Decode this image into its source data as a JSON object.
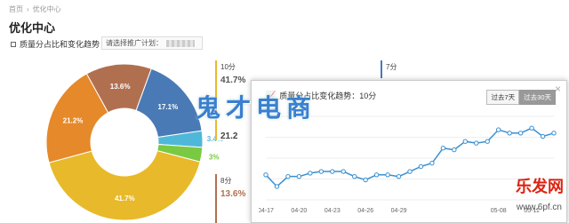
{
  "breadcrumb": {
    "home": "首页",
    "current": "优化中心"
  },
  "page_title": "优化中心",
  "section_label": "质量分占比和变化趋势",
  "plan_select_label": "请选择推广计划：",
  "pie": {
    "slices": [
      {
        "label": "17.1%",
        "value": 17.1,
        "color": "#4a7ab5"
      },
      {
        "label": "3.4%",
        "value": 3.4,
        "color": "#4fb8d8"
      },
      {
        "label": "3%",
        "value": 3.0,
        "color": "#7ac943"
      },
      {
        "label": "41.7%",
        "value": 41.7,
        "color": "#e8b92a"
      },
      {
        "label": "21.2%",
        "value": 21.2,
        "color": "#e5892a"
      },
      {
        "label": "13.6%",
        "value": 13.6,
        "color": "#b07050"
      }
    ]
  },
  "cards": [
    {
      "score": "10分",
      "percent": "41.7%",
      "color": "#e8b92a"
    },
    {
      "score": "7分",
      "percent": "",
      "color": "#4a7ab5"
    },
    {
      "score": "",
      "percent": "21.2",
      "color": "#e5892a"
    },
    {
      "score": "8分",
      "percent": "13.6%",
      "color": "#b07050"
    }
  ],
  "popup": {
    "title": "质量分占比变化趋势：10分",
    "btn_7": "过去7天",
    "btn_30": "过去30天",
    "close": "×",
    "chart_data": {
      "type": "line",
      "x": [
        "04-17",
        "04-18",
        "04-19",
        "04-20",
        "04-21",
        "04-22",
        "04-23",
        "04-24",
        "04-25",
        "04-26",
        "04-27",
        "04-28",
        "04-29",
        "04-30",
        "05-01",
        "05-02",
        "05-03",
        "05-04",
        "05-05",
        "05-06",
        "05-07",
        "05-08",
        "05-09",
        "05-10",
        "05-11",
        "05-12",
        "05-13"
      ],
      "xticks": [
        "04-17",
        "04-20",
        "04-23",
        "04-26",
        "04-29",
        "05-08",
        "05-11"
      ],
      "values": [
        15,
        8,
        14,
        14,
        16,
        17,
        17,
        17,
        14,
        12,
        15,
        15,
        14,
        17,
        20,
        22,
        31,
        30,
        35,
        34,
        35,
        42,
        40,
        40,
        43,
        38,
        40
      ],
      "ylim": [
        0,
        50
      ],
      "color": "#3a8fd0"
    }
  },
  "watermark": {
    "main": "鬼才电商",
    "brand": "乐发网",
    "url": "www.6pf.cn"
  }
}
